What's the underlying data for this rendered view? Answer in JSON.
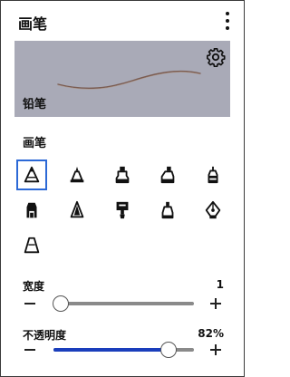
{
  "header": {
    "title": "画笔",
    "menu_icon": "more-vert-icon"
  },
  "preview": {
    "label": "铅笔",
    "settings_icon": "gear-icon",
    "stroke_color": "#7a5c52",
    "background": "#a9aab7"
  },
  "brushes": {
    "label": "画笔",
    "items": [
      {
        "icon": "pencil-icon",
        "selected": true
      },
      {
        "icon": "pen-icon",
        "selected": false
      },
      {
        "icon": "marker-icon",
        "selected": false
      },
      {
        "icon": "highlighter-icon",
        "selected": false
      },
      {
        "icon": "brush-icon",
        "selected": false
      },
      {
        "icon": "crayon-icon",
        "selected": false
      },
      {
        "icon": "charcoal-icon",
        "selected": false
      },
      {
        "icon": "paint-brush-icon",
        "selected": false
      },
      {
        "icon": "chisel-marker-icon",
        "selected": false
      },
      {
        "icon": "fountain-pen-icon",
        "selected": false
      },
      {
        "icon": "eraser-icon",
        "selected": false
      }
    ]
  },
  "width": {
    "label": "宽度",
    "value": "1",
    "level": 0.05
  },
  "opacity": {
    "label": "不透明度",
    "value": "82%",
    "level": 0.82
  },
  "colors": {
    "accent": "#2c69d6",
    "slider_fill": "#1a3ebc"
  }
}
